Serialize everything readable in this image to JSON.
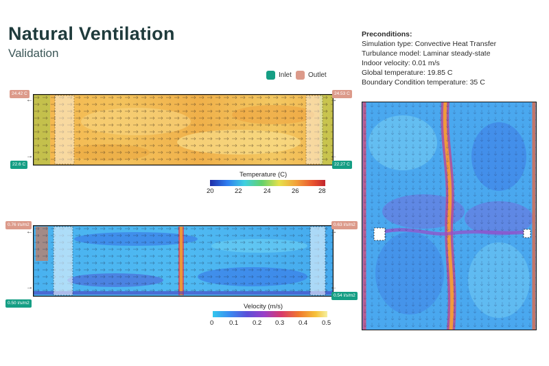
{
  "header": {
    "title": "Natural Ventilation",
    "subtitle": "Validation"
  },
  "preconditions": {
    "heading": "Preconditions:",
    "lines": [
      "Simulation type: Convective Heat Transfer",
      "Turbulance model: Laminar steady-state",
      "Indoor velocity: 0.01 m/s",
      "Global temperature: 19.85 C",
      "Boundary Condition temperature: 35 C"
    ]
  },
  "legend": {
    "inlet": {
      "label": "Inlet",
      "color": "#159e84"
    },
    "outlet": {
      "label": "Outlet",
      "color": "#dc9a8a"
    }
  },
  "temperature_section": {
    "tag_top_left": "24.42 C",
    "tag_top_right": "24.53 C",
    "tag_bottom_left": "22.6 C",
    "tag_bottom_right": "22.27 C",
    "colorbar_title": "Temperature (C)",
    "ticks": [
      "20",
      "22",
      "24",
      "26",
      "28"
    ],
    "colors": [
      "#1f2ea8",
      "#2e7df0",
      "#3fd0e0",
      "#63d16a",
      "#e6e04a",
      "#f2a03a",
      "#e8502e",
      "#c0262e"
    ]
  },
  "velocity_section": {
    "tag_top_left": "0.76 l/s/m2",
    "tag_top_right": "0.63 l/s/m2",
    "tag_bottom_left": "0.50 l/s/m2",
    "tag_bottom_right": "0.54 l/s/m2",
    "colorbar_title": "Velocity (m/s)",
    "ticks": [
      "0",
      "0.1",
      "0.2",
      "0.3",
      "0.4",
      "0.5"
    ],
    "colors": [
      "#33c7ee",
      "#3a8af0",
      "#5b4fd8",
      "#9a3fc8",
      "#d83a6a",
      "#f0782e",
      "#f6c23a",
      "#f5f0a0"
    ]
  }
}
